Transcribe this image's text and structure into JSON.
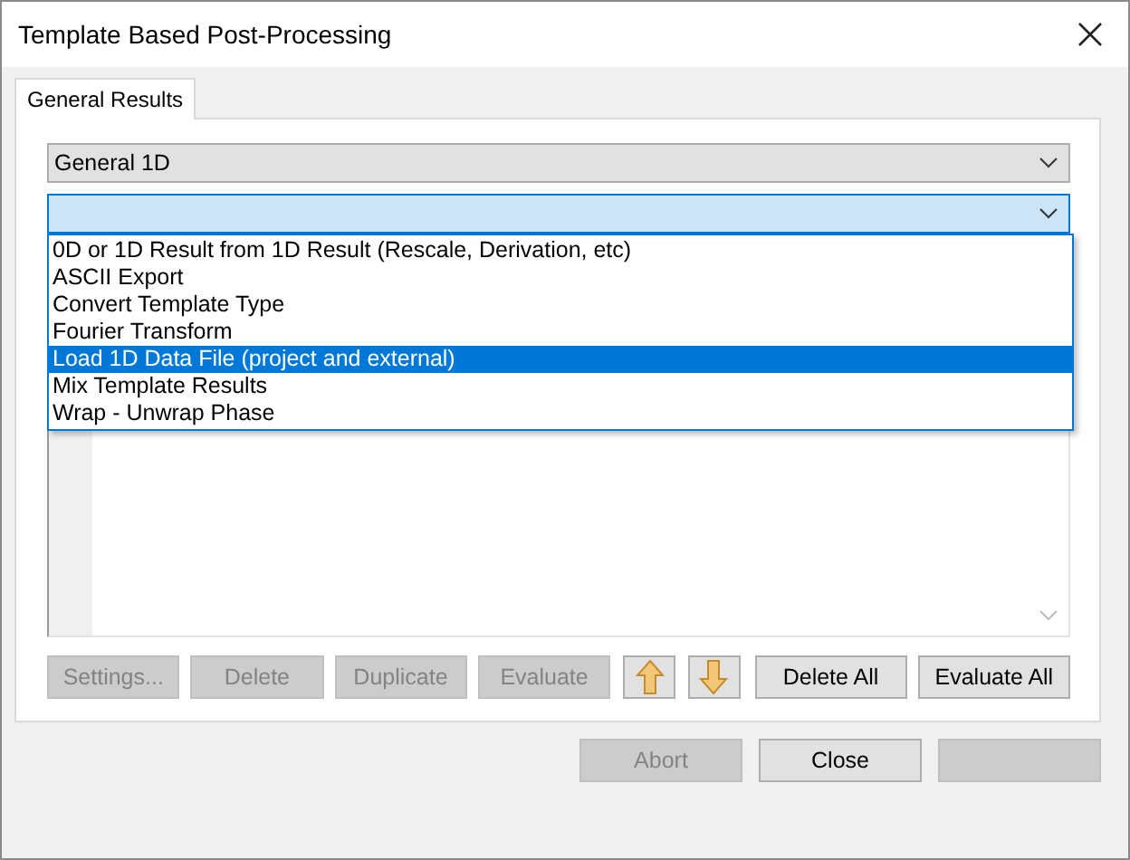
{
  "window": {
    "title": "Template Based Post-Processing"
  },
  "tabs": [
    {
      "label": "General Results",
      "selected": true
    }
  ],
  "category_combo": {
    "value": "General 1D"
  },
  "template_combo": {
    "expanded": true,
    "items": [
      {
        "label": "0D or 1D Result from 1D Result (Rescale, Derivation, etc)",
        "selected": false
      },
      {
        "label": "ASCII Export",
        "selected": false
      },
      {
        "label": "Convert Template Type",
        "selected": false
      },
      {
        "label": "Fourier Transform",
        "selected": false
      },
      {
        "label": "Load 1D Data File (project and external)",
        "selected": true
      },
      {
        "label": "Mix Template Results",
        "selected": false
      },
      {
        "label": "Wrap - Unwrap Phase",
        "selected": false
      }
    ]
  },
  "list_buttons": [
    {
      "kind": "text",
      "label": "Settings...",
      "disabled": true
    },
    {
      "kind": "text",
      "label": "Delete",
      "disabled": true
    },
    {
      "kind": "text",
      "label": "Duplicate",
      "disabled": true
    },
    {
      "kind": "text",
      "label": "Evaluate",
      "disabled": true
    },
    {
      "kind": "up",
      "disabled": false
    },
    {
      "kind": "down",
      "disabled": false
    },
    {
      "kind": "text",
      "label": "Delete All",
      "disabled": false
    },
    {
      "kind": "text",
      "label": "Evaluate All",
      "disabled": false
    }
  ],
  "dialog_buttons": [
    {
      "label": "Abort",
      "disabled": true
    },
    {
      "label": "Close",
      "disabled": false
    }
  ]
}
